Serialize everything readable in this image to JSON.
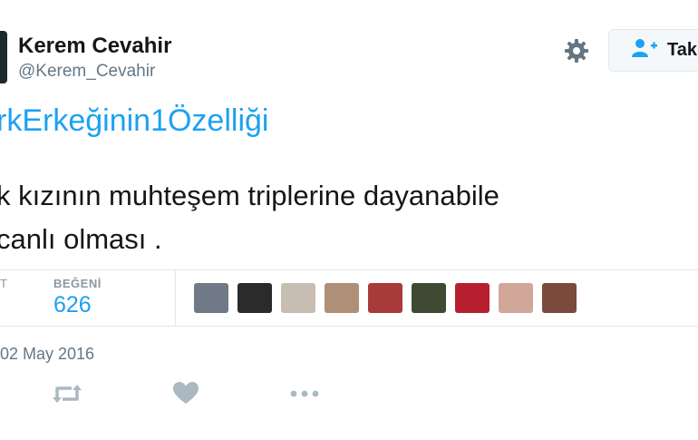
{
  "author": {
    "name": "Kerem Cevahir",
    "handle": "@Kerem_Cevahir"
  },
  "follow_button": {
    "label": "Tak",
    "icon": "person-plus-icon"
  },
  "tweet": {
    "hashtag": "rkErkeğinin1Özelliği",
    "line1": "k kızının muhteşem triplerine dayanabile",
    "line2": "canlı olması ."
  },
  "stats": {
    "partial_label": "T",
    "likes_label": "BEĞENİ",
    "likes_value": "626"
  },
  "likers": [
    {
      "color": "#6f7a86"
    },
    {
      "color": "#2b2b2b"
    },
    {
      "color": "#c7bdb2"
    },
    {
      "color": "#b08f77"
    },
    {
      "color": "#a83a3a"
    },
    {
      "color": "#3e4a33"
    },
    {
      "color": "#b81f2e"
    },
    {
      "color": "#d1a79a"
    },
    {
      "color": "#7b4a3c"
    }
  ],
  "date": "02 May 2016",
  "colors": {
    "accent": "#1da1f2",
    "icon_gray": "#aab8c2"
  }
}
